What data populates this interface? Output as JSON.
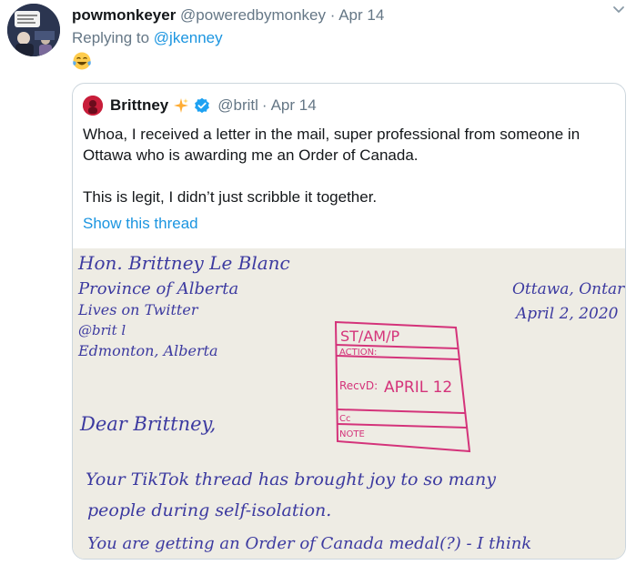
{
  "tweet": {
    "display_name": "powmonkeyer",
    "handle": "@poweredbymonkey",
    "separator": "·",
    "date": "Apr 14",
    "replying_prefix": "Replying to ",
    "replying_handle": "@jkenney",
    "emoji_icon": "tears-of-joy-emoji",
    "avatar_icon": "user-avatar",
    "menu_icon": "chevron-down-icon"
  },
  "quote": {
    "display_name": "Brittney",
    "sparkle_icon": "sparkles-emoji",
    "verified_icon": "verified-badge-icon",
    "handle": "@britl",
    "separator": "·",
    "date": "Apr 14",
    "text_p1": "Whoa, I received a letter in the mail, super professional from someone in Ottawa who is awarding me an Order of Canada.",
    "text_p2": "This is legit, I didn’t just scribble it together.",
    "show_thread": "Show this thread"
  },
  "letter": {
    "address_lines": [
      "Hon. Brittney Le Blanc",
      "Province of Alberta",
      "Lives on Twitter",
      "@brit l",
      "Edmonton, Alberta"
    ],
    "place": "Ottawa, Ontar",
    "letter_date": "April 2, 2020",
    "stamp_title": "ST/AM/P",
    "stamp_action": "ACTION:",
    "stamp_recd": "RecvD:",
    "stamp_recd_value": "APRIL 12",
    "stamp_cc": "Cc",
    "stamp_note": "NOTE",
    "greeting": "Dear Brittney,",
    "body_lines": [
      "Your TikTok thread has brought joy to so many",
      "people during self-isolation.",
      "You are getting an Order of Canada medal(?) - I think"
    ]
  },
  "colors": {
    "link": "#1b95e0",
    "muted": "#657786",
    "text": "#14171a",
    "ink": "#3c3aa0",
    "stamp": "#d4337a",
    "paper": "#eeece4"
  }
}
